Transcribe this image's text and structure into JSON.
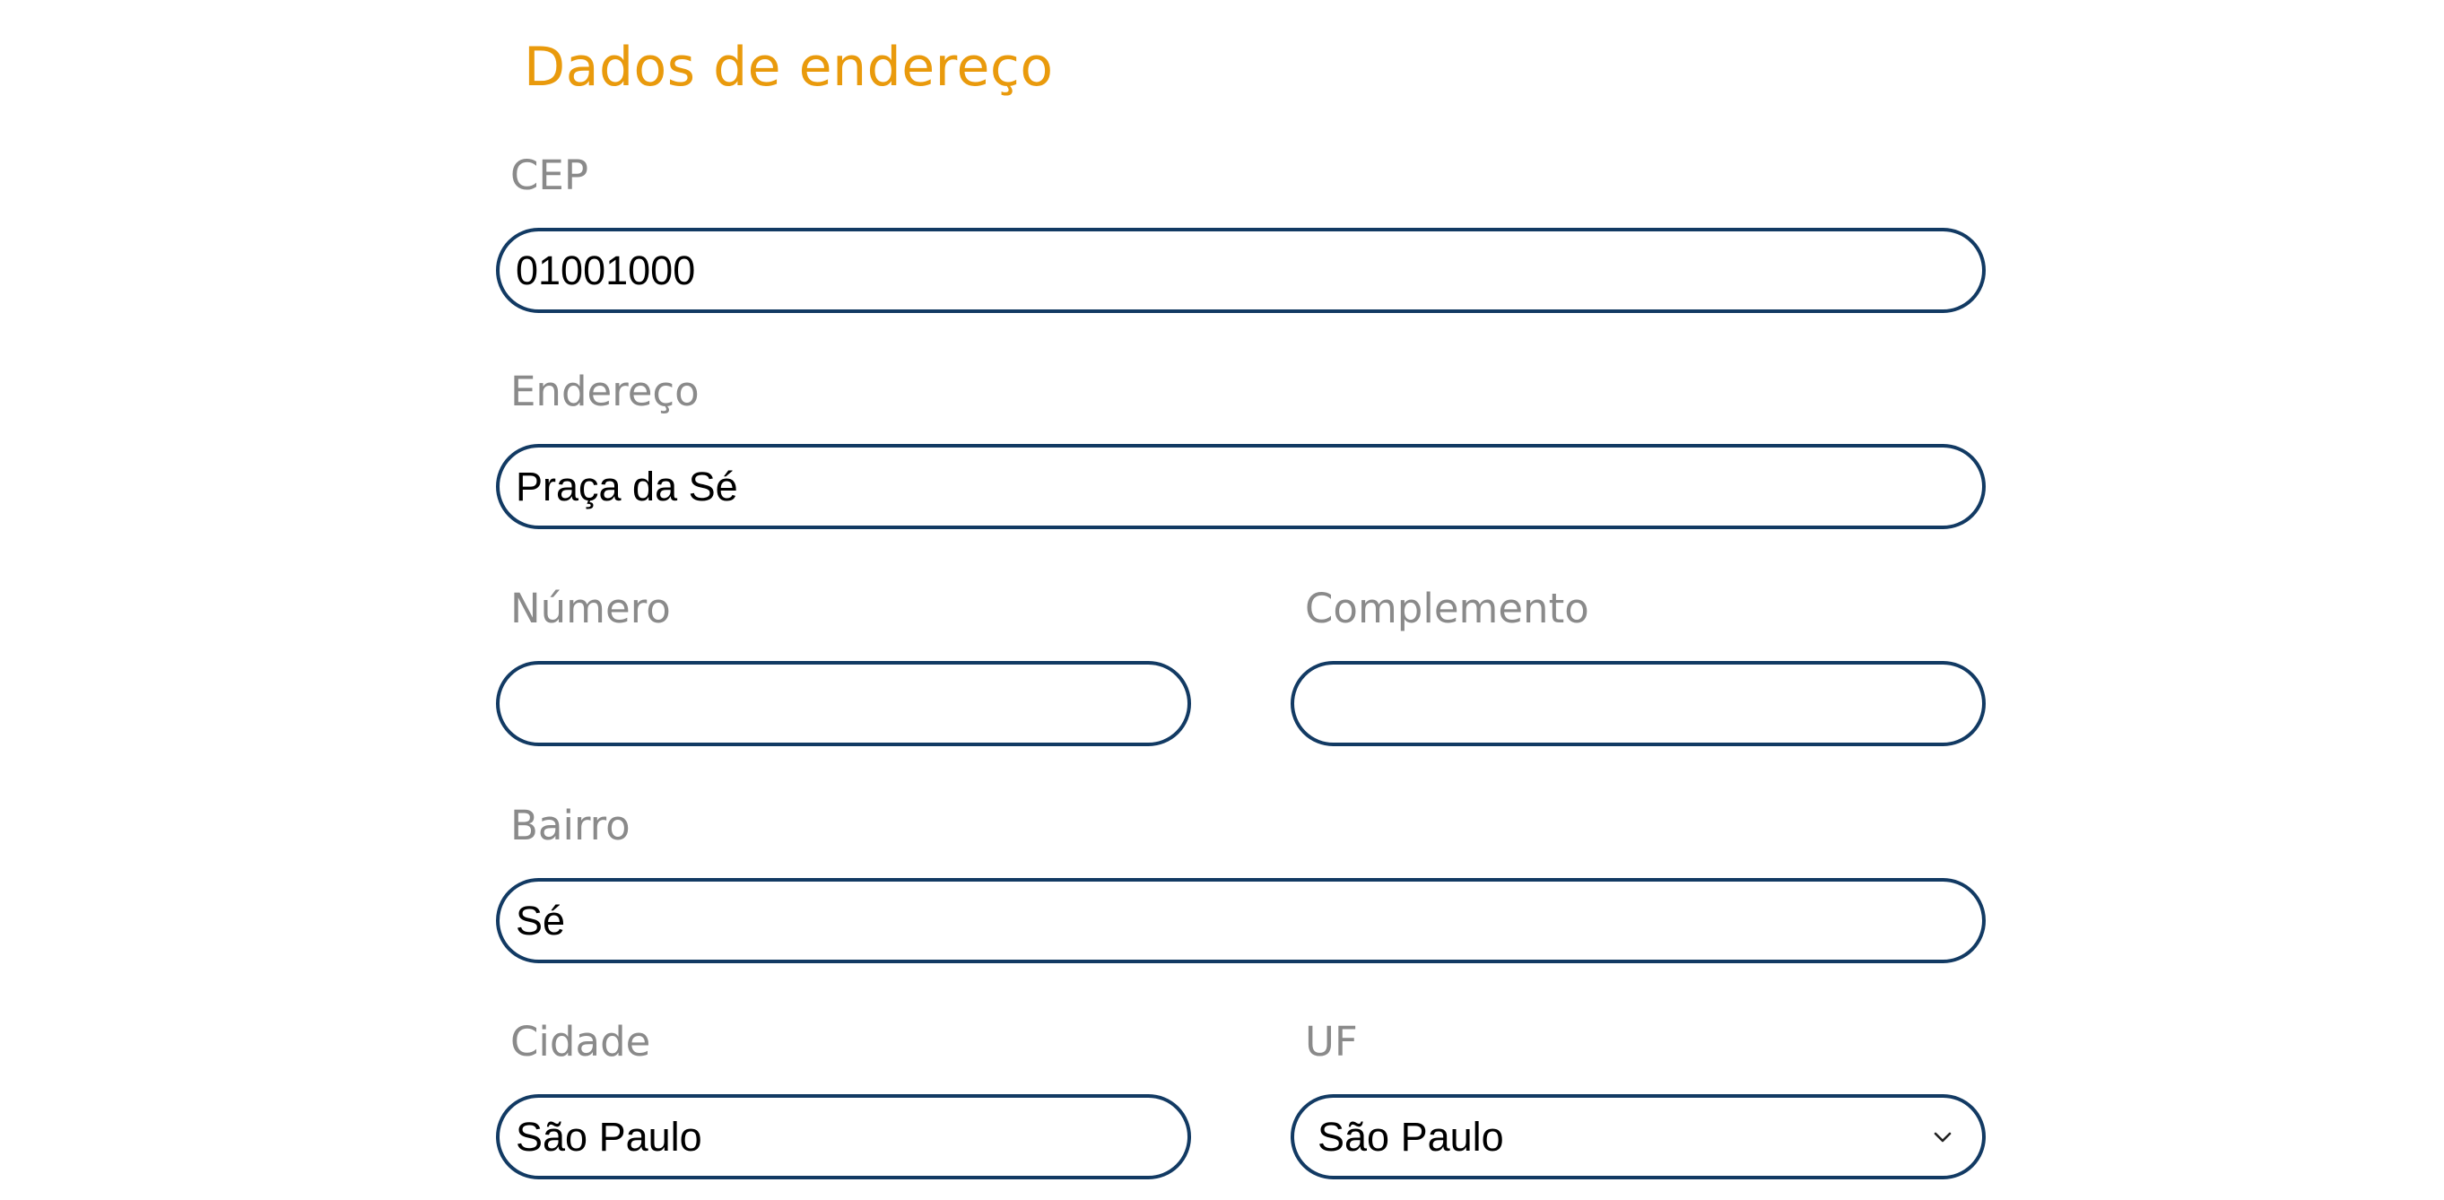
{
  "section": {
    "title": "Dados de endereço"
  },
  "fields": {
    "cep": {
      "label": "CEP",
      "value": "01001000"
    },
    "endereco": {
      "label": "Endereço",
      "value": "Praça da Sé"
    },
    "numero": {
      "label": "Número",
      "value": ""
    },
    "complemento": {
      "label": "Complemento",
      "value": ""
    },
    "bairro": {
      "label": "Bairro",
      "value": "Sé"
    },
    "cidade": {
      "label": "Cidade",
      "value": "São Paulo"
    },
    "uf": {
      "label": "UF",
      "selected": "São Paulo"
    }
  },
  "colors": {
    "title": "#e99a0c",
    "label": "#8a8a8a",
    "field_border": "#123a63"
  },
  "icons": {
    "uf_dropdown": "chevron-down-icon"
  }
}
